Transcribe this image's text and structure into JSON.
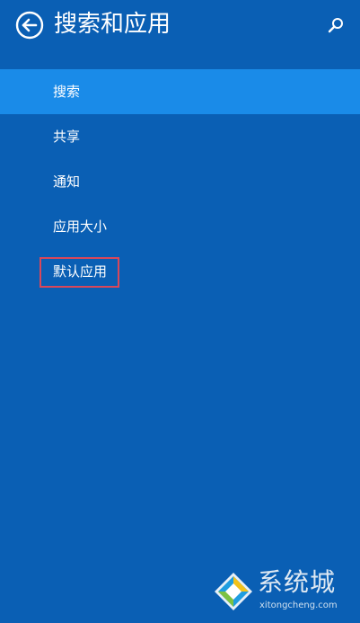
{
  "header": {
    "title": "搜索和应用",
    "back_icon": "back-arrow-circle-icon",
    "search_icon": "search-icon"
  },
  "nav": {
    "items": [
      {
        "label": "搜索",
        "selected": true
      },
      {
        "label": "共享",
        "selected": false
      },
      {
        "label": "通知",
        "selected": false
      },
      {
        "label": "应用大小",
        "selected": false
      },
      {
        "label": "默认应用",
        "selected": false,
        "highlighted": true
      }
    ]
  },
  "watermark": {
    "name": "系统城",
    "url": "xitongcheng.com"
  },
  "colors": {
    "background": "#0a5fb4",
    "selected": "#1a8be8",
    "highlight_border": "#d9475a"
  }
}
